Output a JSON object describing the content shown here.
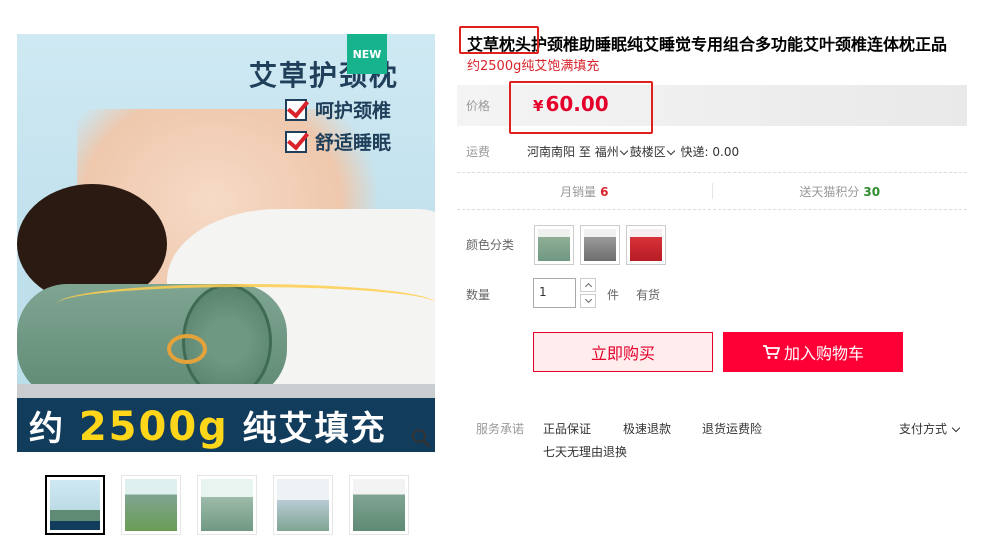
{
  "gallery": {
    "new_badge": "NEW",
    "image_title": "艾草护颈枕",
    "features": [
      "呵护颈椎",
      "舒适睡眠"
    ],
    "banner_prefix": "约",
    "banner_weight": "2500g",
    "banner_suffix": "纯艾填充",
    "thumbnails": [
      "thumb-1",
      "thumb-2",
      "thumb-3",
      "thumb-4",
      "thumb-5"
    ]
  },
  "product": {
    "title": "艾草枕头护颈椎助睡眠纯艾睡觉专用组合多功能艾叶颈椎连体枕正品",
    "subtitle": "约2500g纯艾饱满填充"
  },
  "price": {
    "label": "价格",
    "currency": "¥",
    "value": "60.00"
  },
  "shipping": {
    "label": "运费",
    "from": "河南南阳",
    "to_word": "至",
    "city": "福州",
    "district": "鼓楼区",
    "fee": "快递: 0.00"
  },
  "stats": {
    "monthly_sales_label": "月销量",
    "monthly_sales": "6",
    "points_label": "送天猫积分",
    "points": "30"
  },
  "options": {
    "color_label": "颜色分类",
    "colors": [
      "green",
      "gray",
      "red"
    ]
  },
  "quantity": {
    "label": "数量",
    "value": "1",
    "unit": "件",
    "stock": "有货"
  },
  "actions": {
    "buy_now": "立即购买",
    "add_to_cart": "加入购物车"
  },
  "services": {
    "label": "服务承诺",
    "items": [
      "正品保证",
      "极速退款",
      "退货运费险"
    ],
    "item2": "七天无理由退换",
    "payment": "支付方式"
  },
  "colors": {
    "accent": "#e4002b",
    "cart_button": "#ff0036",
    "highlight_box": "#e0201f",
    "points_green": "#2e8b2e"
  }
}
